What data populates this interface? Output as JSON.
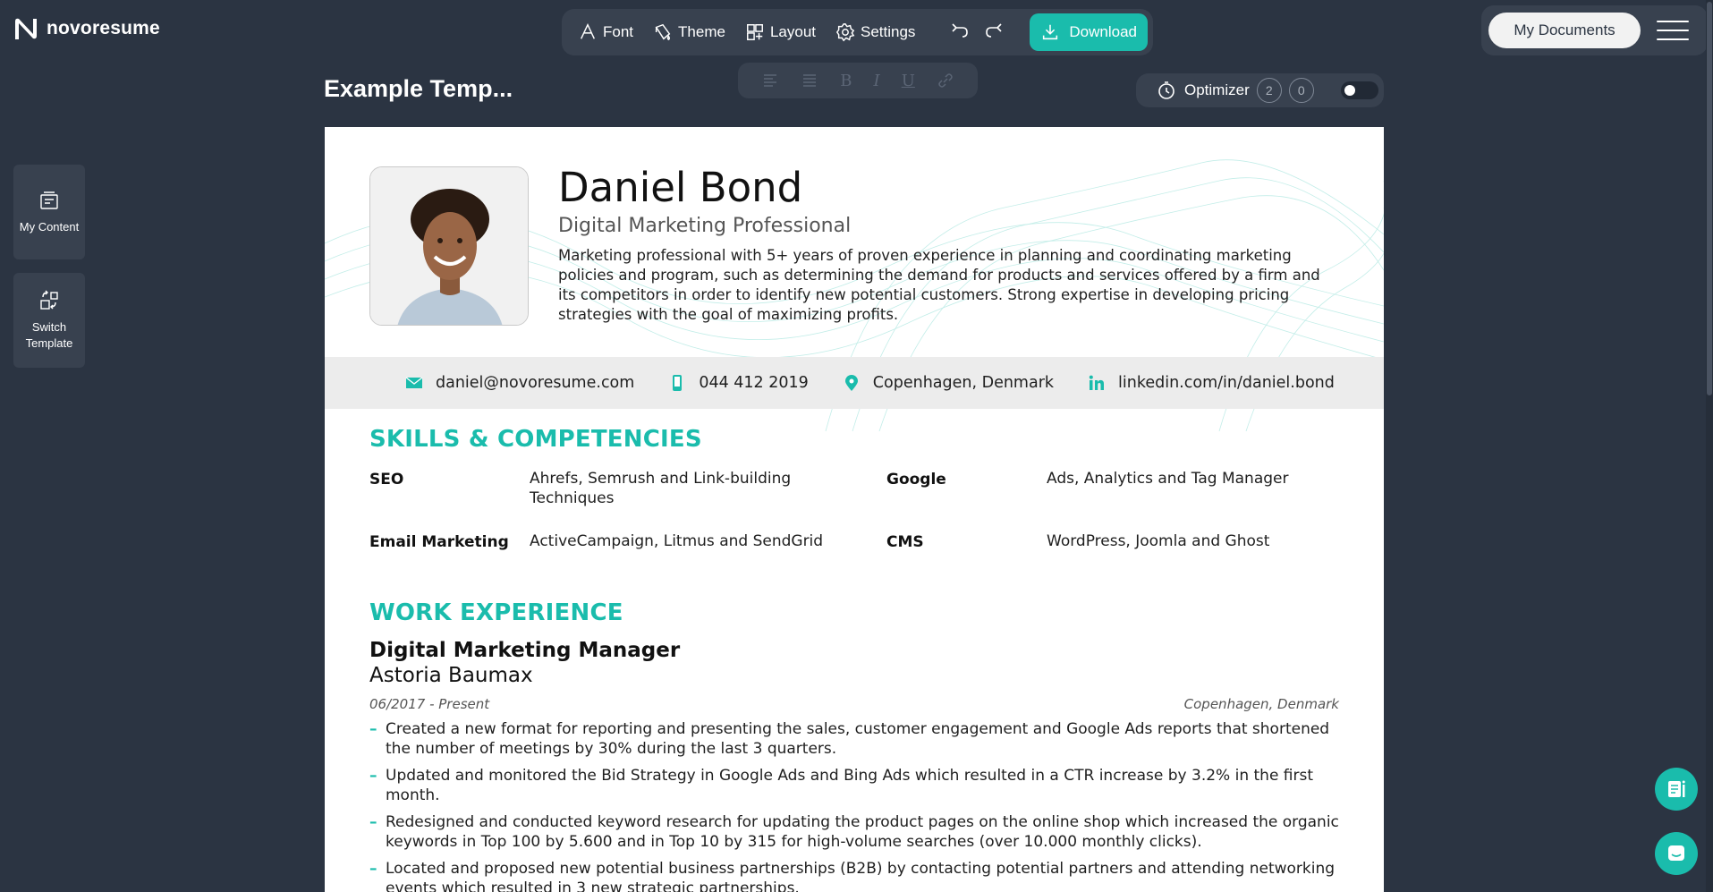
{
  "app": {
    "logo_text": "novoresume"
  },
  "toolbar": {
    "font_label": "Font",
    "theme_label": "Theme",
    "layout_label": "Layout",
    "settings_label": "Settings",
    "download_label": "Download"
  },
  "header_right": {
    "my_documents_label": "My Documents"
  },
  "document": {
    "title": "Example Temp..."
  },
  "format_bar": {
    "bold": "B",
    "italic": "I",
    "underline": "U"
  },
  "optimizer": {
    "label": "Optimizer",
    "count_a": "2",
    "count_b": "0",
    "enabled": false
  },
  "sidebar": {
    "items": [
      {
        "label": "My Content",
        "icon": "content-icon"
      },
      {
        "label": "Switch Template",
        "icon": "switch-template-icon"
      }
    ]
  },
  "resume": {
    "name": "Daniel Bond",
    "headline": "Digital Marketing Professional",
    "summary": "Marketing professional with 5+ years of proven experience in planning and coordinating marketing policies and program, such as determining the demand for products and services offered by a firm and its competitors in order to identify new potential customers. Strong expertise in developing pricing strategies with the goal of maximizing profits.",
    "contacts": {
      "email": "daniel@novoresume.com",
      "phone": "044 412 2019",
      "location": "Copenhagen, Denmark",
      "linkedin": "linkedin.com/in/daniel.bond"
    },
    "skills_title": "SKILLS & COMPETENCIES",
    "skills": [
      {
        "name": "SEO",
        "value": "Ahrefs, Semrush and Link-building Techniques"
      },
      {
        "name": "Google",
        "value": "Ads, Analytics and Tag Manager"
      },
      {
        "name": "Email Marketing",
        "value": "ActiveCampaign, Litmus and SendGrid"
      },
      {
        "name": "CMS",
        "value": "WordPress, Joomla and Ghost"
      }
    ],
    "experience_title": "WORK EXPERIENCE",
    "jobs": [
      {
        "title": "Digital Marketing Manager",
        "company": "Astoria Baumax",
        "dates": "06/2017 - Present",
        "location": "Copenhagen, Denmark",
        "bullets": [
          "Created a new format for reporting and presenting the sales, customer engagement and Google Ads reports that shortened the number of meetings by 30% during the last 3 quarters.",
          "Updated and monitored the Bid Strategy in Google Ads and Bing Ads which resulted in a CTR increase by 3.2% in the first month.",
          "Redesigned and conducted keyword research for updating the product pages on the online shop which increased the organic keywords in Top 100 by 5.600 and in Top 10 by 315 for high-volume searches (over 10.000 monthly clicks).",
          "Located and proposed new potential business partnerships (B2B) by contacting potential partners and attending networking events which resulted in 3 new strategic partnerships."
        ]
      }
    ]
  },
  "colors": {
    "accent": "#1abcac",
    "background": "#2b3442",
    "panel": "#38414f"
  }
}
